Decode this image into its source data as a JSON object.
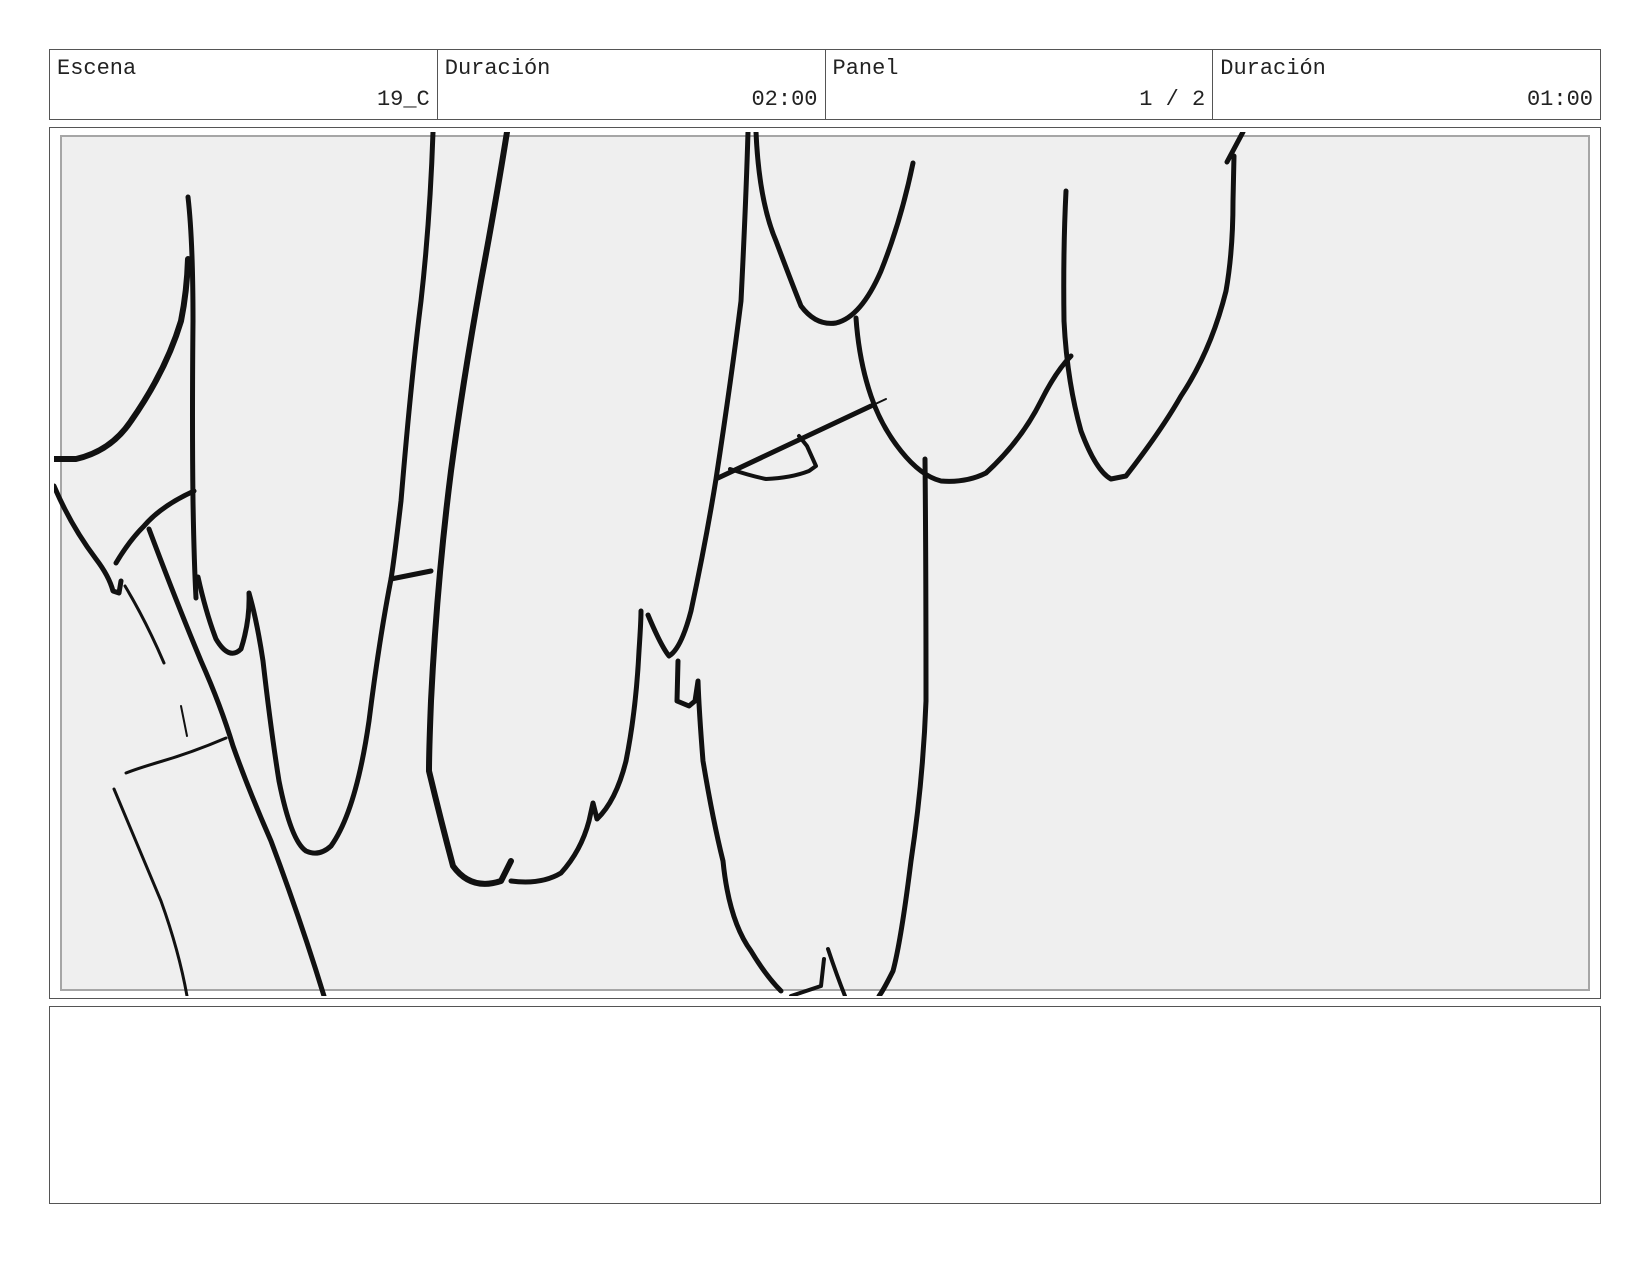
{
  "header": {
    "scene": {
      "label": "Escena",
      "value": "19_C"
    },
    "scene_duration": {
      "label": "Duración",
      "value": "02:00"
    },
    "panel": {
      "label": "Panel",
      "value": "1 / 2"
    },
    "panel_duration": {
      "label": "Duración",
      "value": "01:00"
    }
  },
  "notes": {
    "text": ""
  }
}
